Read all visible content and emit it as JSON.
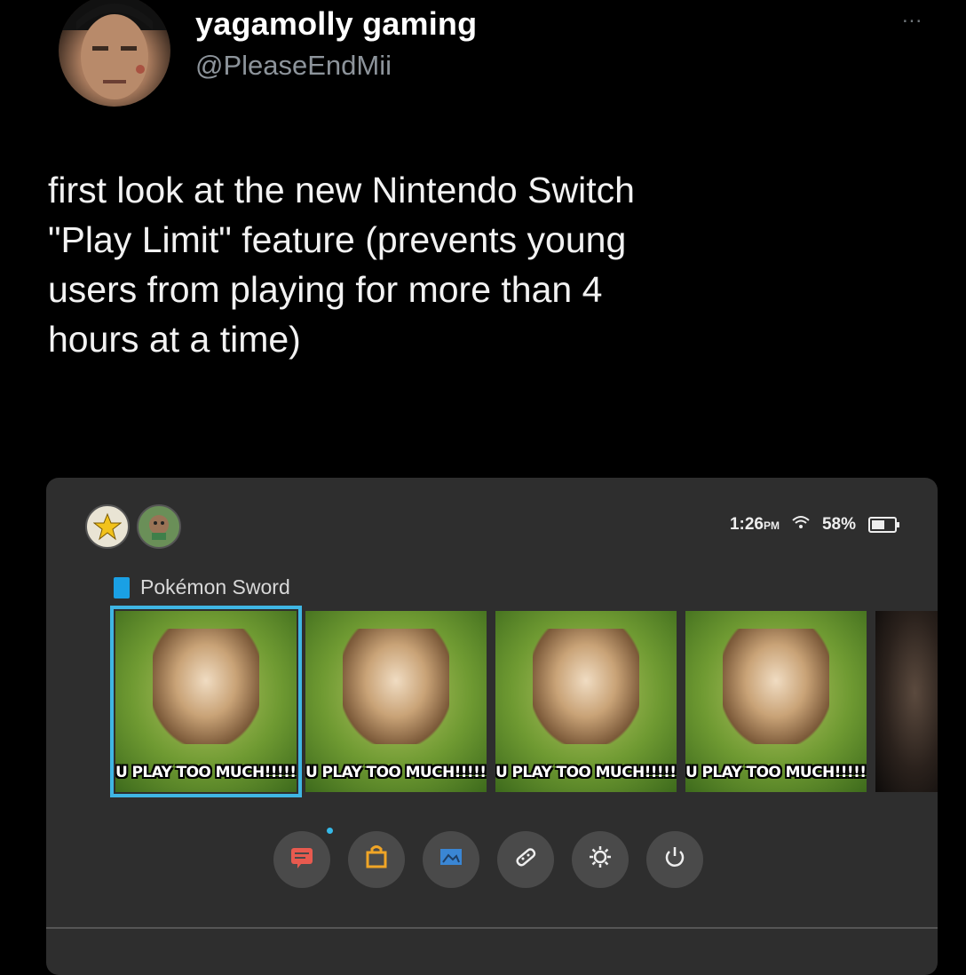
{
  "tweet": {
    "display_name": "yagamolly gaming",
    "handle": "@PleaseEndMii",
    "more": "...",
    "text_lines": [
      "first look at the new Nintendo Switch",
      "\"Play Limit\" feature (prevents young",
      "users from playing for more than 4",
      "hours at a time)"
    ]
  },
  "switch": {
    "status": {
      "time": "1:26",
      "ampm": "PM",
      "battery": "58%"
    },
    "game_title": "Pokémon Sword",
    "tiles": [
      {
        "caption": "U PLAY TOO MUCH!!!!!!",
        "selected": true
      },
      {
        "caption": "U PLAY TOO MUCH!!!!!!",
        "selected": false
      },
      {
        "caption": "U PLAY TOO MUCH!!!!!!",
        "selected": false
      },
      {
        "caption": "U PLAY TOO MUCH!!!!!!",
        "selected": false
      }
    ],
    "buttons": [
      {
        "name": "news-button",
        "icon": "news-icon",
        "glyph": "☷",
        "color": "#e85a4f"
      },
      {
        "name": "eshop-button",
        "icon": "shopping-bag-icon",
        "glyph": "⛶",
        "color": "#f0a526"
      },
      {
        "name": "album-button",
        "icon": "album-icon",
        "glyph": "▣",
        "color": "#3a86d4"
      },
      {
        "name": "controllers-button",
        "icon": "controller-icon",
        "glyph": "⌘",
        "color": "#eeeeee"
      },
      {
        "name": "settings-button",
        "icon": "gear-icon",
        "glyph": "⚙",
        "color": "#eeeeee"
      },
      {
        "name": "power-button",
        "icon": "power-icon",
        "glyph": "⏻",
        "color": "#eeeeee"
      }
    ]
  }
}
